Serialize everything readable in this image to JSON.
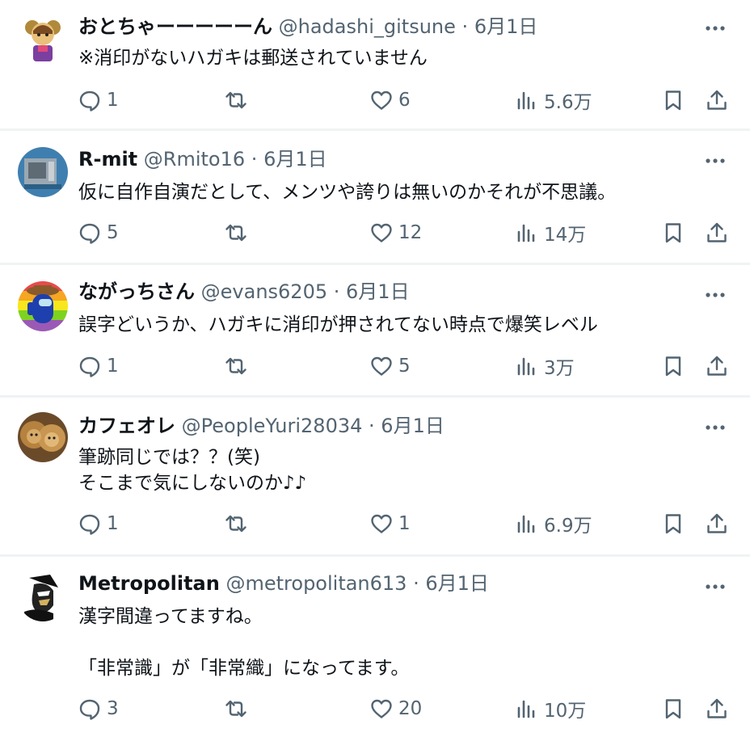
{
  "colors": {
    "text": "#0f1419",
    "muted": "#536471",
    "divider": "#eff3f4"
  },
  "tweets": [
    {
      "name": "おとちゃーーーーーん",
      "handle": "@hadashi_gitsune",
      "sep": "·",
      "date": "6月1日",
      "lines": [
        "※消印がないハガキは郵送されていません"
      ],
      "replies": "1",
      "retweets": "",
      "likes": "6",
      "views": "5.6万",
      "avatar": "character-avatar"
    },
    {
      "name": "R-mit",
      "handle": "@Rmito16",
      "sep": "·",
      "date": "6月1日",
      "lines": [
        "仮に自作自演だとして、メンツや誇りは無いのかそれが不思議。"
      ],
      "replies": "5",
      "retweets": "",
      "likes": "12",
      "views": "14万",
      "avatar": "machine-avatar"
    },
    {
      "name": "ながっちさん",
      "handle": "@evans6205",
      "sep": "·",
      "date": "6月1日",
      "lines": [
        "誤字どいうか、ハガキに消印が押されてない時点で爆笑レベル"
      ],
      "replies": "1",
      "retweets": "",
      "likes": "5",
      "views": "3万",
      "avatar": "crewmate-avatar"
    },
    {
      "name": "カフェオレ",
      "handle": "@PeopleYuri28034",
      "sep": "·",
      "date": "6月1日",
      "lines": [
        "筆跡同じでは？？(笑)",
        "そこまで気にしないのか♪♪"
      ],
      "replies": "1",
      "retweets": "",
      "likes": "1",
      "views": "6.9万",
      "avatar": "lion-avatar"
    },
    {
      "name": "Metropolitan",
      "handle": "@metropolitan613",
      "sep": "·",
      "date": "6月1日",
      "lines": [
        "漢字間違ってますね。",
        "",
        "「非常識」が「非常織」になってます。"
      ],
      "replies": "3",
      "retweets": "",
      "likes": "20",
      "views": "10万",
      "avatar": "samurai-avatar"
    }
  ]
}
